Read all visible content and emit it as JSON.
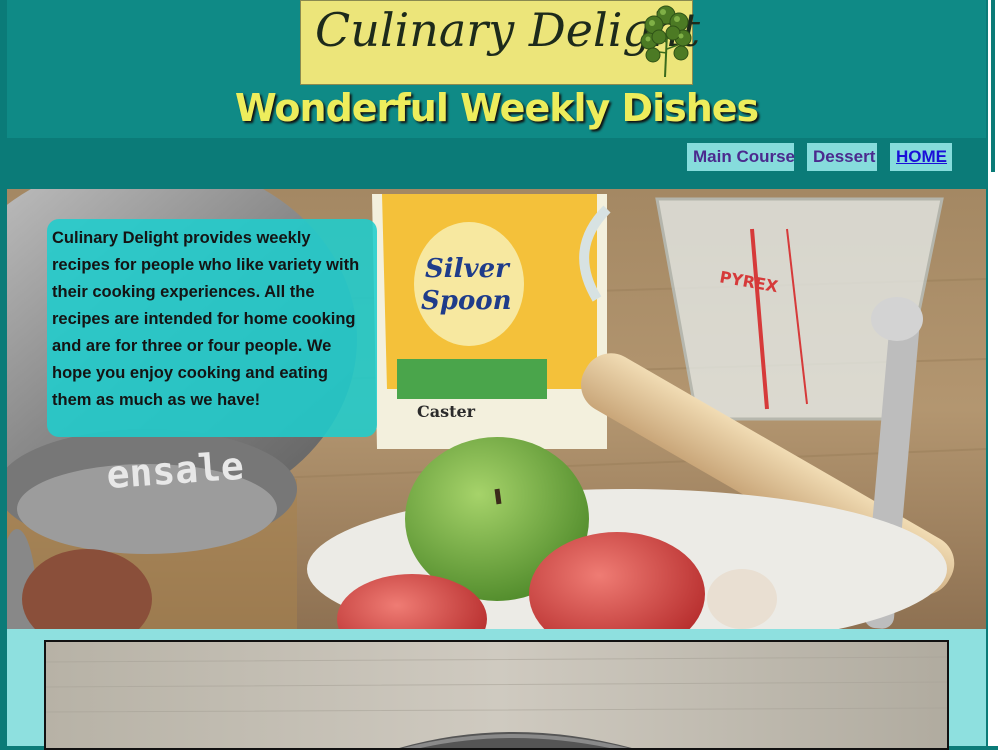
{
  "logo": {
    "text": "Culinary Delight",
    "icon": "parsley-icon"
  },
  "header": {
    "title": "Wonderful Weekly Dishes"
  },
  "nav": {
    "items": [
      {
        "label": "Main Course"
      },
      {
        "label": "Dessert"
      },
      {
        "label": "HOME"
      }
    ]
  },
  "hero": {
    "intro": "Culinary Delight provides weekly recipes for people who like variety with their cooking experiences. All the recipes are intended for home cooking and are for three or four people. We hope you enjoy cooking and eating them as much as we have!",
    "photo_labels": {
      "sugar_brand": "Silver Spoon",
      "sugar_type": "Caster",
      "jug_brand": "PYREX",
      "colander_text": "ensale"
    }
  },
  "colors": {
    "background": "#0b7b78",
    "header": "#0f8a86",
    "title_yellow": "#eded5c",
    "logo_box": "#ece57a",
    "nav_bg": "#86dcdc",
    "nav_text": "#4b2a8e",
    "link": "#1a10d8",
    "intro_box": "#1fcdcd",
    "content_bg": "#8ee0df"
  }
}
